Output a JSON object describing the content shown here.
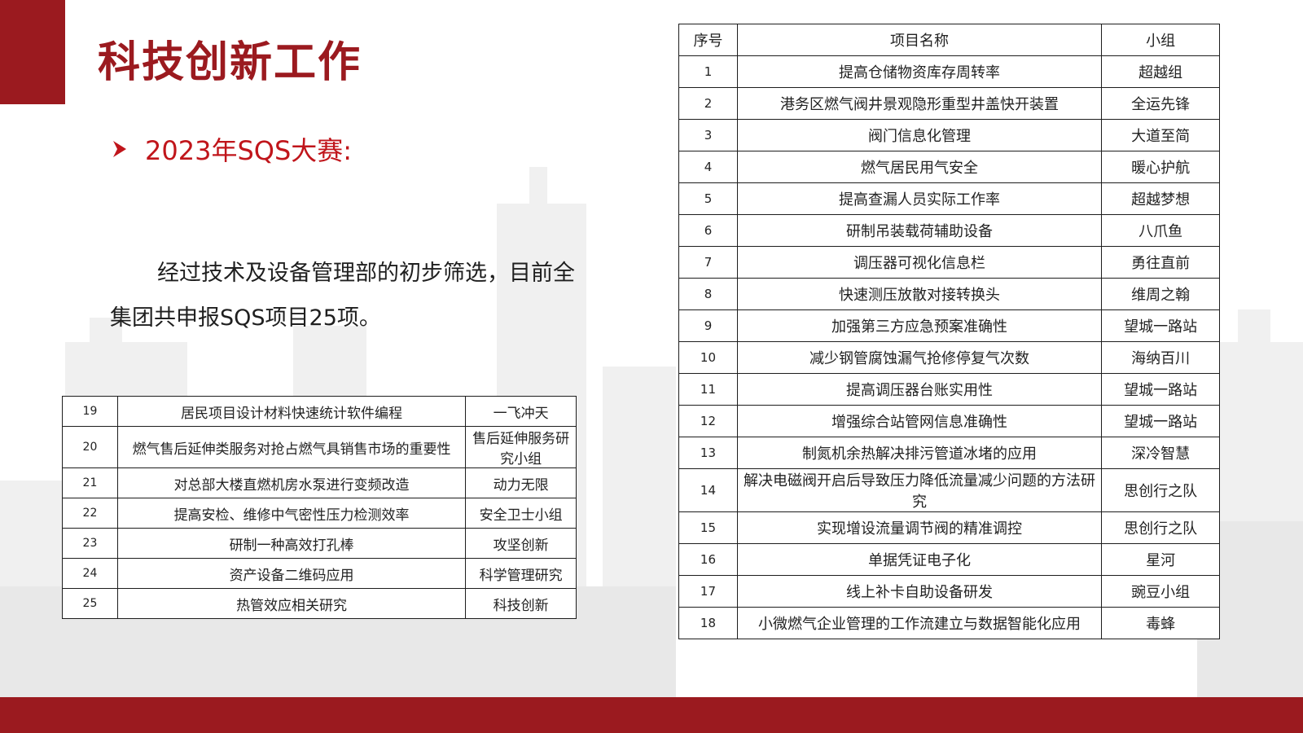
{
  "title": "科技创新工作",
  "subtitle": "2023年SQS大赛:",
  "body_text": "经过技术及设备管理部的初步筛选，目前全集团共申报SQS项目25项。",
  "colors": {
    "brand_red": "#9b1a1f",
    "accent_red": "#c0151b"
  },
  "main_table": {
    "headers": [
      "序号",
      "项目名称",
      "小组"
    ],
    "rows": [
      [
        "1",
        "提高仓储物资库存周转率",
        "超越组"
      ],
      [
        "2",
        "港务区燃气阀井景观隐形重型井盖快开装置",
        "全运先锋"
      ],
      [
        "3",
        "阀门信息化管理",
        "大道至简"
      ],
      [
        "4",
        "燃气居民用气安全",
        "暖心护航"
      ],
      [
        "5",
        "提高查漏人员实际工作率",
        "超越梦想"
      ],
      [
        "6",
        "研制吊装载荷辅助设备",
        "八爪鱼"
      ],
      [
        "7",
        "调压器可视化信息栏",
        "勇往直前"
      ],
      [
        "8",
        "快速测压放散对接转换头",
        "维周之翰"
      ],
      [
        "9",
        "加强第三方应急预案准确性",
        "望城一路站"
      ],
      [
        "10",
        "减少钢管腐蚀漏气抢修停复气次数",
        "海纳百川"
      ],
      [
        "11",
        "提高调压器台账实用性",
        "望城一路站"
      ],
      [
        "12",
        "增强综合站管网信息准确性",
        "望城一路站"
      ],
      [
        "13",
        "制氮机余热解决排污管道冰堵的应用",
        "深冷智慧"
      ],
      [
        "14",
        "解决电磁阀开启后导致压力降低流量减少问题的方法研究",
        "思创行之队"
      ],
      [
        "15",
        "实现增设流量调节阀的精准调控",
        "思创行之队"
      ],
      [
        "16",
        "单据凭证电子化",
        "星河"
      ],
      [
        "17",
        "线上补卡自助设备研发",
        "豌豆小组"
      ],
      [
        "18",
        "小微燃气企业管理的工作流建立与数据智能化应用",
        "毒蜂"
      ]
    ]
  },
  "side_table": {
    "rows": [
      [
        "19",
        "居民项目设计材料快速统计软件编程",
        "一飞冲天"
      ],
      [
        "20",
        "燃气售后延伸类服务对抢占燃气具销售市场的重要性",
        "售后延伸服务研究小组"
      ],
      [
        "21",
        "对总部大楼直燃机房水泵进行变频改造",
        "动力无限"
      ],
      [
        "22",
        "提高安检、维修中气密性压力检测效率",
        "安全卫士小组"
      ],
      [
        "23",
        "研制一种高效打孔棒",
        "攻坚创新"
      ],
      [
        "24",
        "资产设备二维码应用",
        "科学管理研究"
      ],
      [
        "25",
        "热管效应相关研究",
        "科技创新"
      ]
    ]
  }
}
